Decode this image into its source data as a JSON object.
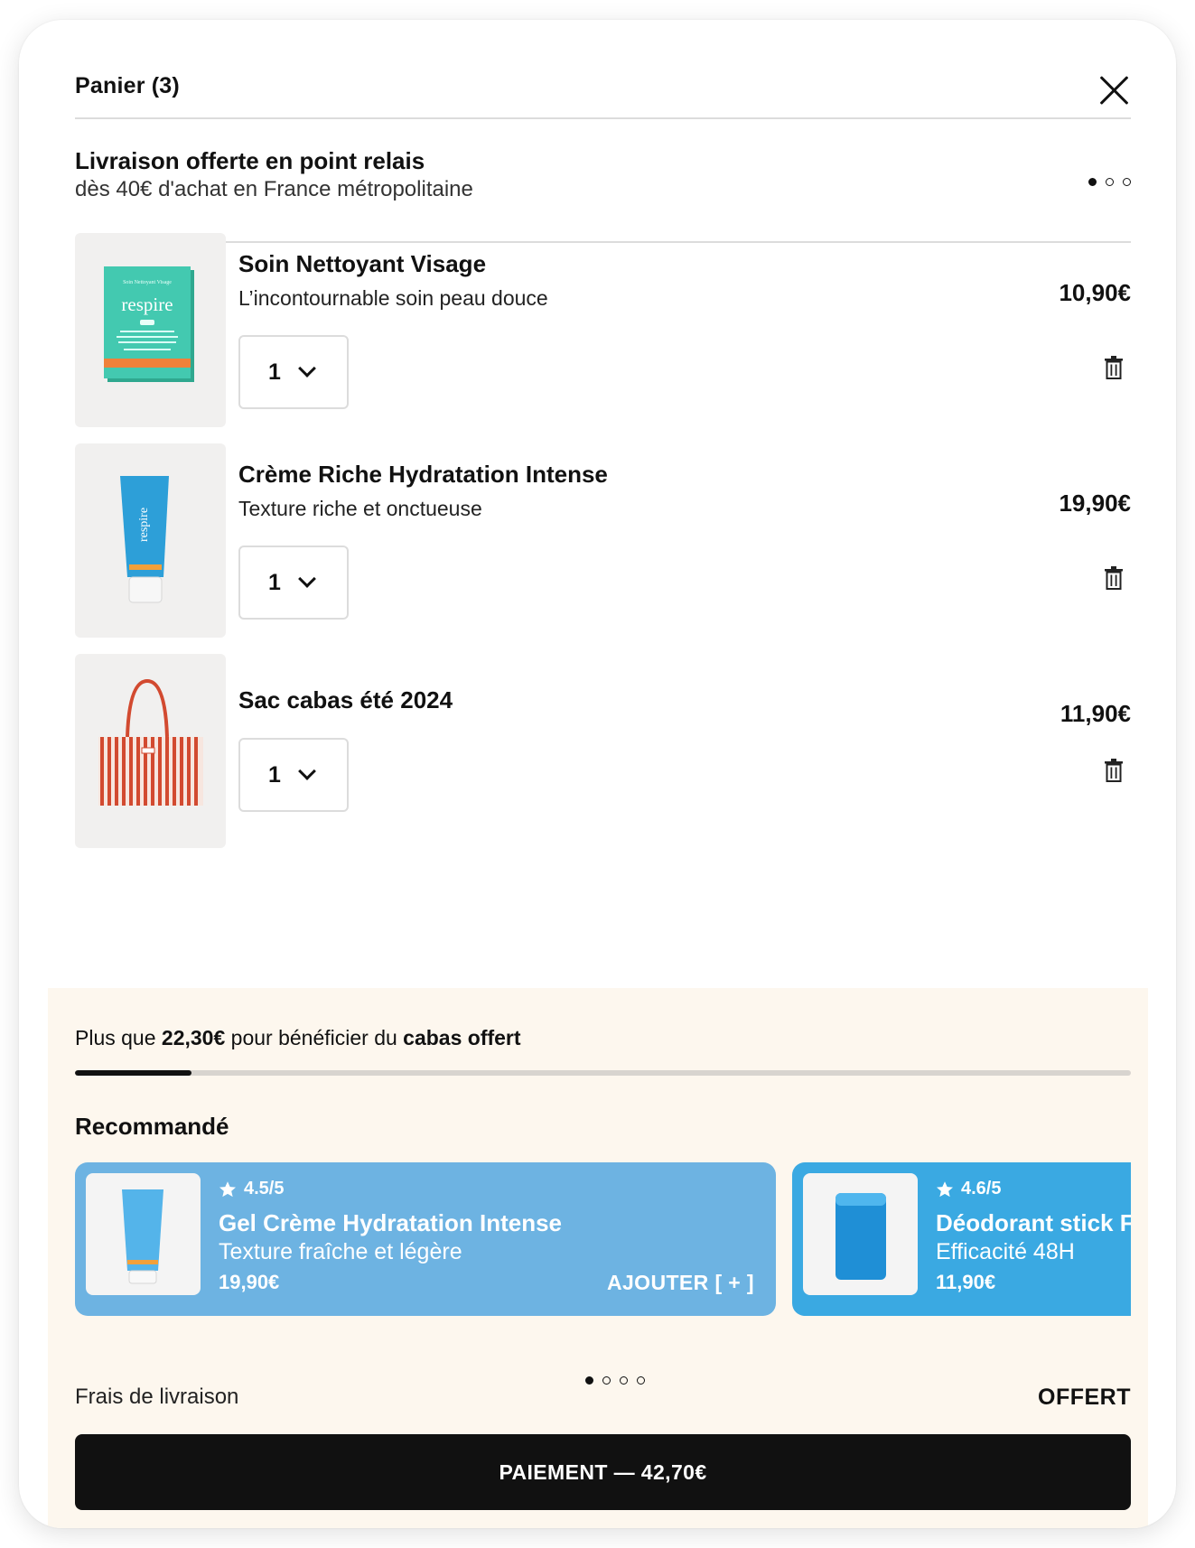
{
  "cart": {
    "title": "Panier (3)",
    "close_icon": "close-icon"
  },
  "shipping_banner": {
    "title": "Livraison offerte en point relais",
    "subtitle": "dès 40€ d'achat en France métropolitaine"
  },
  "items": [
    {
      "name": "Soin Nettoyant Visage",
      "description": "L’incontournable soin peau douce",
      "price": "10,90€",
      "quantity": "1",
      "image": "cleanser-box",
      "image_brand": "respire"
    },
    {
      "name": "Crème Riche Hydratation Intense",
      "description": "Texture riche et onctueuse",
      "price": "19,90€",
      "quantity": "1",
      "image": "cream-tube",
      "image_brand": "respire"
    },
    {
      "name": "Sac cabas été 2024",
      "description": "",
      "price": "11,90€",
      "quantity": "1",
      "image": "striped-tote-bag"
    }
  ],
  "promo": {
    "prefix": "Plus que ",
    "amount": "22,30€",
    "middle": " pour bénéficier du ",
    "reward": "cabas offert",
    "progress_fraction": 0.11
  },
  "recommendations": {
    "title": "Recommandé",
    "cards": [
      {
        "rating": "4.5/5",
        "name": "Gel Crème Hydratation Intense",
        "description": "Texture fraîche et légère",
        "price": "19,90€",
        "add_label": "AJOUTER [ + ]",
        "color": "#6db3e2"
      },
      {
        "rating": "4.6/5",
        "name": "Déodorant stick Fl",
        "description": "Efficacité 48H",
        "price": "11,90€",
        "add_label": "",
        "color": "#3aa9e2"
      }
    ]
  },
  "shipping": {
    "label": "Frais de livraison",
    "value": "OFFERT"
  },
  "checkout": {
    "label": "PAIEMENT — 42,70€"
  },
  "colors": {
    "accent": "#111111",
    "panel_bottom_bg": "#fdf7ee"
  }
}
